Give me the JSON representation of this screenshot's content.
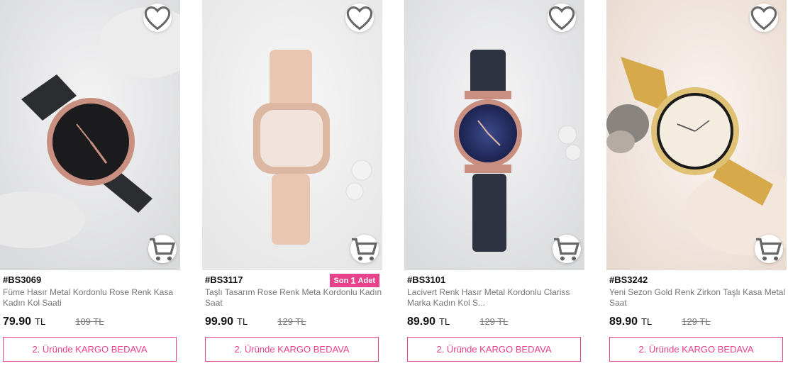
{
  "colors": {
    "accent": "#e8428c"
  },
  "products": [
    {
      "sku": "#BS3069",
      "title": "Füme Hasır Metal Kordonlu Rose Renk Kasa Kadın Kol Saati",
      "price": "79.90",
      "currency": "TL",
      "old_price": "109 TL",
      "cargo_label": "2. Üründe KARGO BEDAVA",
      "stock_badge": null,
      "image_icon": "watch-photo"
    },
    {
      "sku": "#BS3117",
      "title": "Taşlı Tasarım Rose Renk Meta Kordonlu Kadın Saat",
      "price": "99.90",
      "currency": "TL",
      "old_price": "129 TL",
      "cargo_label": "2. Üründe KARGO BEDAVA",
      "stock_badge": {
        "prefix": "Son",
        "count": "1",
        "suffix": "Adet"
      },
      "image_icon": "watch-photo"
    },
    {
      "sku": "#BS3101",
      "title": "Lacivert Renk Hasır Metal Kordonlu Clariss Marka Kadın Kol S...",
      "price": "89.90",
      "currency": "TL",
      "old_price": "129 TL",
      "cargo_label": "2. Üründe KARGO BEDAVA",
      "stock_badge": null,
      "image_icon": "watch-photo"
    },
    {
      "sku": "#BS3242",
      "title": "Yeni Sezon Gold Renk Zirkon Taşlı Kasa Metal Saat",
      "price": "89.90",
      "currency": "TL",
      "old_price": "129 TL",
      "cargo_label": "2. Üründe KARGO BEDAVA",
      "stock_badge": null,
      "image_icon": "watch-photo"
    }
  ]
}
